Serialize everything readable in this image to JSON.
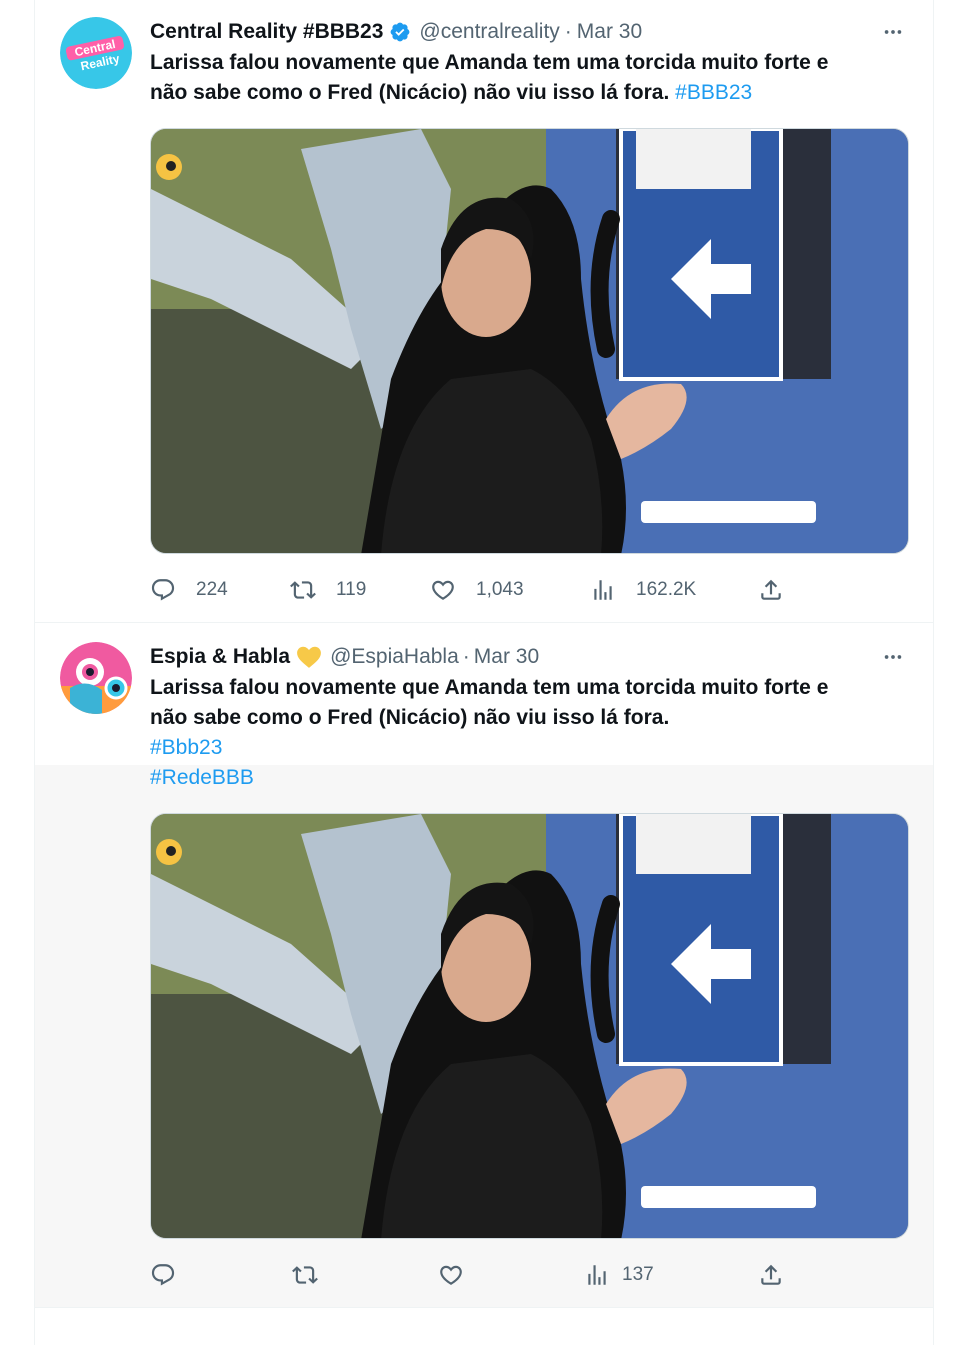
{
  "tweets": [
    {
      "name": "Central Reality #BBB23",
      "handle": "@centralreality",
      "separator": "·",
      "date": "Mar 30",
      "avatar_text": [
        "Central",
        "Reality"
      ],
      "text_line1": "Larissa falou novamente que Amanda tem uma torcida muito forte e",
      "text_line2": "não sabe como o Fred (Nicácio) não viu isso lá fora.",
      "hashtag": "#BBB23",
      "replies": "224",
      "retweets": "119",
      "likes": "1,043",
      "views": "162.2K",
      "verified": true
    },
    {
      "name": "Espia & Habla",
      "handle": "@EspiaHabla",
      "separator": "·",
      "date": "Mar 30",
      "text_line1": "Larissa falou novamente que Amanda tem uma torcida muito forte e",
      "text_line2": "não sabe como o Fred (Nicácio) não viu isso lá fora.",
      "hashtag1": "#Bbb23",
      "hashtag2": "#RedeBBB",
      "views": "137"
    }
  ],
  "colors": {
    "accent": "#1d9bf0",
    "secondary_text": "#536471",
    "border": "#eff3f4",
    "heart_badge": "#f7c948"
  },
  "icons": [
    "more-icon",
    "reply-icon",
    "retweet-icon",
    "like-icon",
    "views-icon",
    "share-icon",
    "verified-badge-icon",
    "yellow-heart-icon"
  ]
}
